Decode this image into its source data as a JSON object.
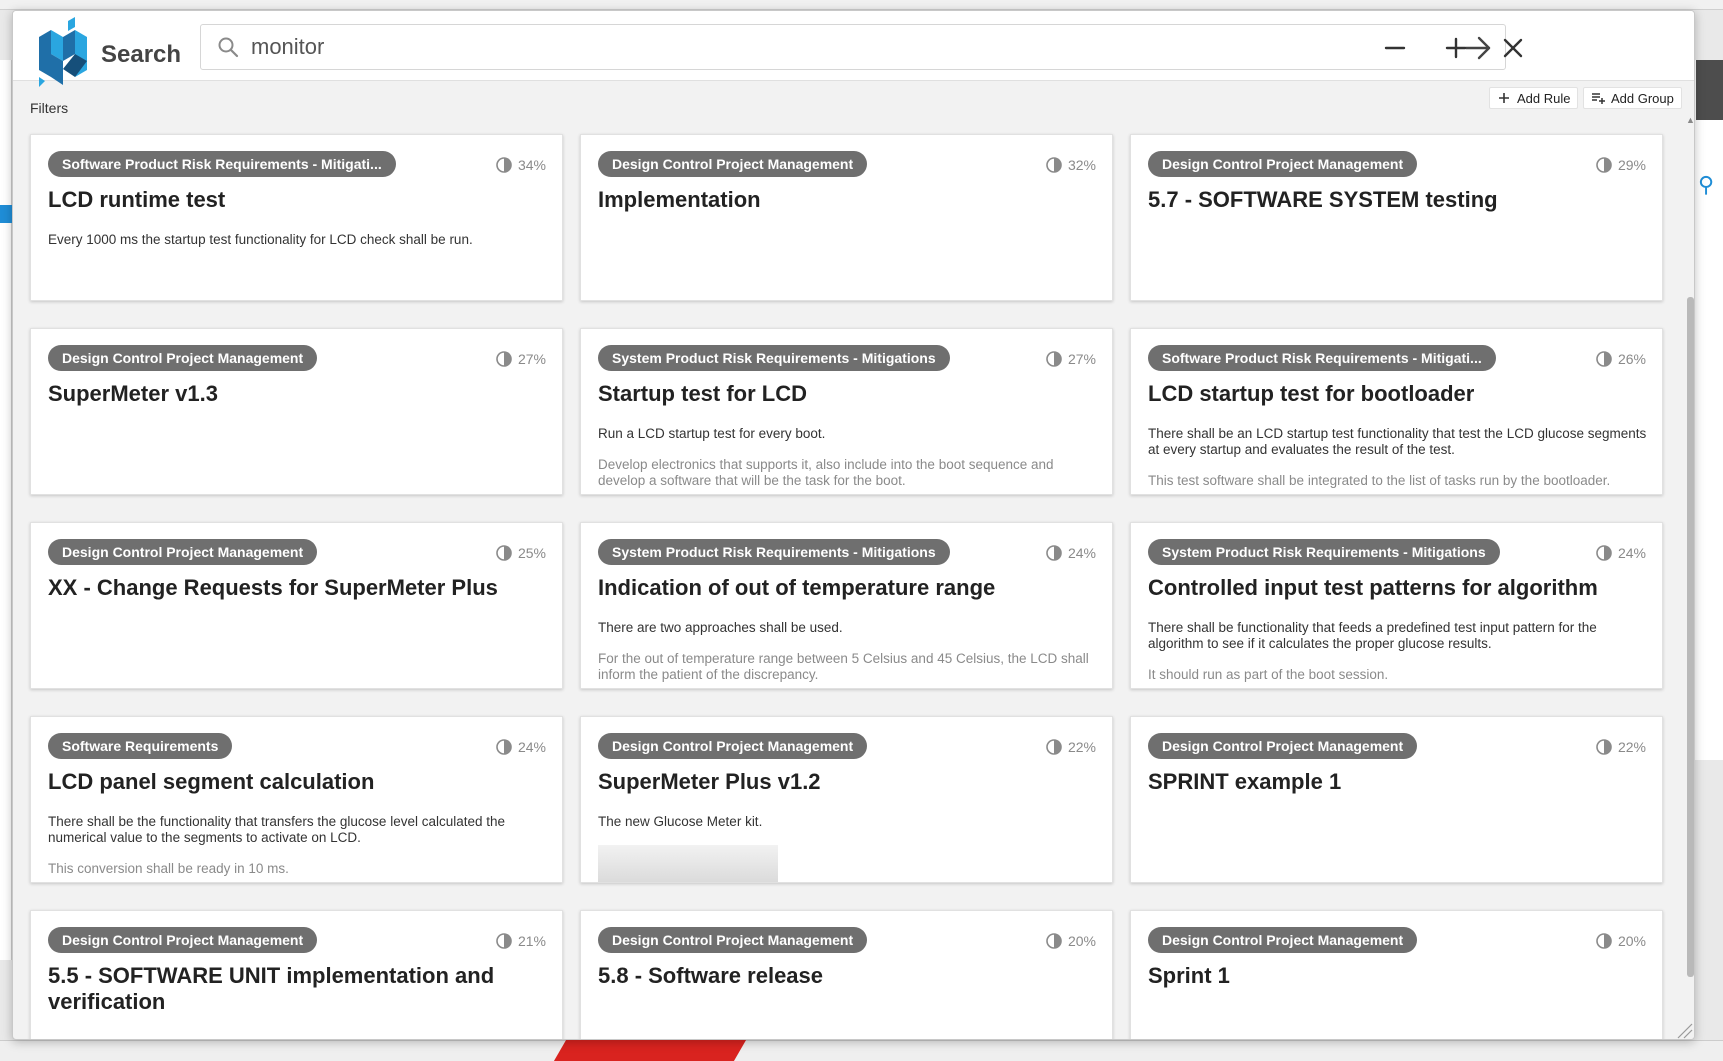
{
  "header": {
    "title": "Search",
    "search_value": "monitor",
    "search_placeholder": ""
  },
  "filters": {
    "label": "Filters",
    "add_rule": "Add Rule",
    "add_group": "Add Group"
  },
  "icons": {
    "logo": "brand-logo-icon",
    "search": "search-icon",
    "go": "arrow-right-icon",
    "minimize": "minimize-icon",
    "maximize": "plus-icon",
    "close": "close-icon",
    "score": "relevance-half-circle-icon"
  },
  "colors": {
    "tag_bg": "#6f6f6f",
    "logo_primary": "#1f6fa8",
    "logo_accent": "#2aa6e0"
  },
  "results": [
    {
      "tag": "Software Product Risk Requirements - Mitigati...",
      "score": "34%",
      "title": "LCD runtime test",
      "desc": [
        "Every 1000 ms the startup test functionality for LCD check shall be run."
      ]
    },
    {
      "tag": "Design Control Project Management",
      "score": "32%",
      "title": "Implementation",
      "desc": []
    },
    {
      "tag": "Design Control Project Management",
      "score": "29%",
      "title": "5.7 - SOFTWARE SYSTEM testing",
      "desc": []
    },
    {
      "tag": "Design Control Project Management",
      "score": "27%",
      "title": "SuperMeter v1.3",
      "desc": []
    },
    {
      "tag": "System Product Risk Requirements - Mitigations",
      "score": "27%",
      "title": "Startup test for LCD",
      "desc": [
        "Run a LCD startup test for every boot.",
        "Develop electronics that supports it, also include into the boot sequence and develop a software that will be the task for the boot."
      ]
    },
    {
      "tag": "Software Product Risk Requirements - Mitigati...",
      "score": "26%",
      "title": "LCD startup test for bootloader",
      "desc": [
        "There shall be an LCD startup test functionality that test the LCD glucose segments at every startup and evaluates the result of the test.",
        "This test software shall be integrated to the list of tasks run by the bootloader."
      ]
    },
    {
      "tag": "Design Control Project Management",
      "score": "25%",
      "title": "XX - Change Requests for SuperMeter Plus",
      "desc": []
    },
    {
      "tag": "System Product Risk Requirements - Mitigations",
      "score": "24%",
      "title": "Indication of out of temperature range",
      "desc": [
        "There are two approaches shall be used.",
        "For the out of temperature range between 5 Celsius and 45 Celsius, the LCD shall inform the patient of the discrepancy."
      ]
    },
    {
      "tag": "System Product Risk Requirements - Mitigations",
      "score": "24%",
      "title": "Controlled input test patterns for algorithm",
      "desc": [
        "There shall be functionality that feeds a predefined test input pattern for the algorithm to see if it calculates the proper glucose results.",
        "It should run as part of the boot session."
      ]
    },
    {
      "tag": "Software Requirements",
      "score": "24%",
      "title": "LCD panel segment calculation",
      "desc": [
        "There shall be the functionality that transfers the glucose level calculated the numerical value to the segments to activate on LCD.",
        "This conversion shall be ready in 10 ms."
      ]
    },
    {
      "tag": "Design Control Project Management",
      "score": "22%",
      "title": "SuperMeter Plus v1.2",
      "desc": [
        "The new Glucose Meter kit."
      ],
      "thumb": true
    },
    {
      "tag": "Design Control Project Management",
      "score": "22%",
      "title": "SPRINT example 1",
      "desc": []
    },
    {
      "tag": "Design Control Project Management",
      "score": "21%",
      "title": "5.5 - SOFTWARE UNIT implementation and verification",
      "desc": []
    },
    {
      "tag": "Design Control Project Management",
      "score": "20%",
      "title": "5.8 - Software release",
      "desc": []
    },
    {
      "tag": "Design Control Project Management",
      "score": "20%",
      "title": "Sprint 1",
      "desc": []
    }
  ]
}
